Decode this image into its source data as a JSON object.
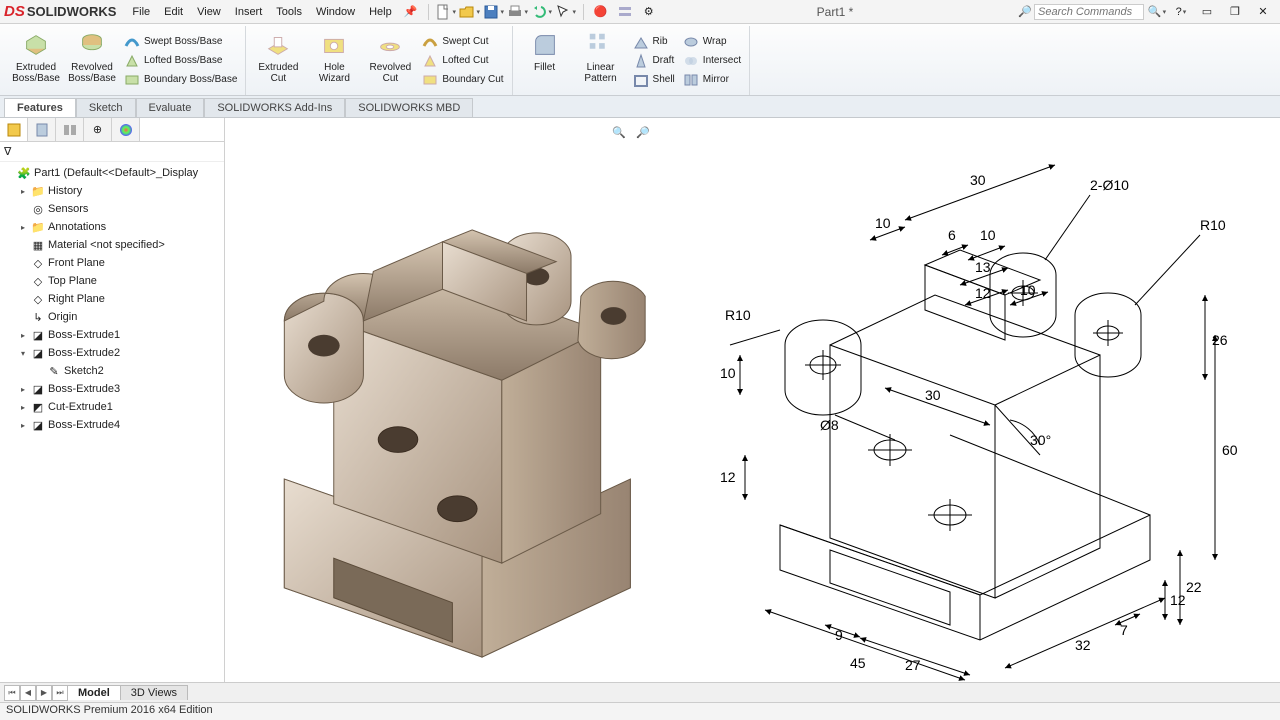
{
  "app": {
    "logo_prefix": "DS",
    "logo_text": "SOLIDWORKS"
  },
  "menu": {
    "file": "File",
    "edit": "Edit",
    "view": "View",
    "insert": "Insert",
    "tools": "Tools",
    "window": "Window",
    "help": "Help"
  },
  "title": "Part1 *",
  "search": {
    "placeholder": "Search Commands"
  },
  "ribbon": {
    "extruded_boss": "Extruded Boss/Base",
    "revolved_boss": "Revolved Boss/Base",
    "swept_boss": "Swept Boss/Base",
    "lofted_boss": "Lofted Boss/Base",
    "boundary_boss": "Boundary Boss/Base",
    "extruded_cut": "Extruded Cut",
    "hole_wizard": "Hole Wizard",
    "revolved_cut": "Revolved Cut",
    "swept_cut": "Swept Cut",
    "lofted_cut": "Lofted Cut",
    "boundary_cut": "Boundary Cut",
    "fillet": "Fillet",
    "linear_pattern": "Linear Pattern",
    "rib": "Rib",
    "draft": "Draft",
    "shell": "Shell",
    "wrap": "Wrap",
    "intersect": "Intersect",
    "mirror": "Mirror"
  },
  "ribbon_tabs": {
    "features": "Features",
    "sketch": "Sketch",
    "evaluate": "Evaluate",
    "addins": "SOLIDWORKS Add-Ins",
    "mbd": "SOLIDWORKS MBD"
  },
  "tree": {
    "root": "Part1  (Default<<Default>_Display",
    "history": "History",
    "sensors": "Sensors",
    "annotations": "Annotations",
    "material": "Material <not specified>",
    "front": "Front Plane",
    "top": "Top Plane",
    "right": "Right Plane",
    "origin": "Origin",
    "be1": "Boss-Extrude1",
    "be2": "Boss-Extrude2",
    "sk2": "Sketch2",
    "be3": "Boss-Extrude3",
    "ce1": "Cut-Extrude1",
    "be4": "Boss-Extrude4"
  },
  "bottom": {
    "model": "Model",
    "views3d": "3D Views"
  },
  "status_text": "SOLIDWORKS Premium 2016 x64 Edition",
  "drawing": {
    "d30a": "30",
    "d10a": "10",
    "d6": "6",
    "d10b": "10",
    "d13": "13",
    "d12a": "12",
    "d10c": "10",
    "r10a": "R10",
    "r10b": "R10",
    "dia10": "2-Ø10",
    "d26": "26",
    "d60": "60",
    "dia8": "Ø8",
    "d30b": "30",
    "ang30": "30°",
    "d12b": "12",
    "d10d": "10",
    "d45": "45",
    "d9": "9",
    "d27": "27",
    "d7": "7",
    "d12c": "12",
    "d22": "22",
    "d32": "32"
  }
}
